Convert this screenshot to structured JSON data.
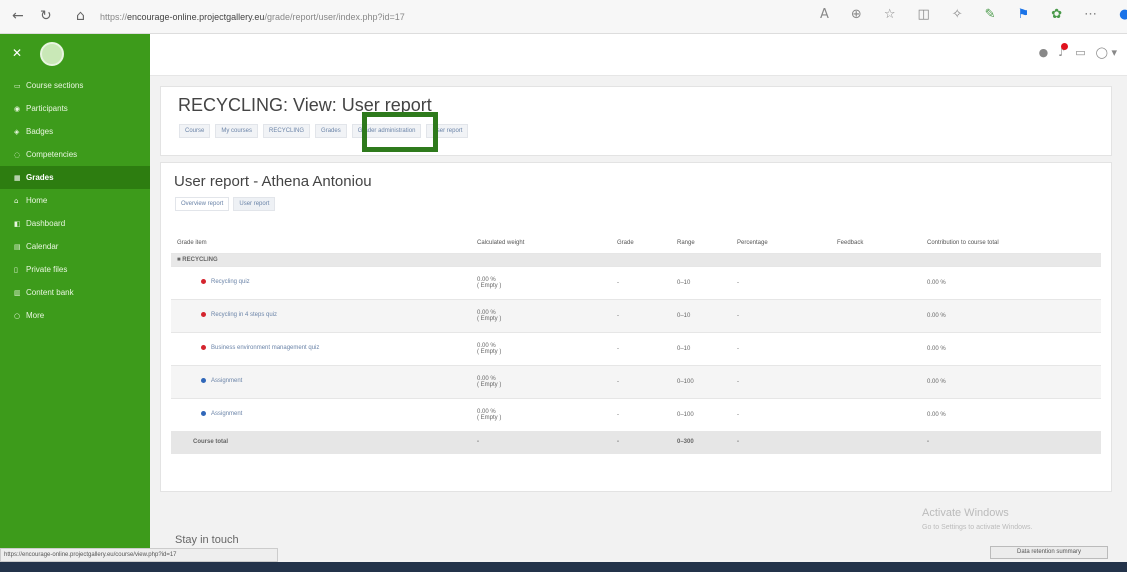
{
  "browser": {
    "url_prefix": "https://",
    "url_host": "encourage-online.projectgallery.eu",
    "url_path": "/grade/report/user/index.php?id=17"
  },
  "sidebar": {
    "items": [
      {
        "label": "Course sections",
        "icon": "folder-icon",
        "active": false
      },
      {
        "label": "Participants",
        "icon": "people-icon",
        "active": false
      },
      {
        "label": "Badges",
        "icon": "badge-icon",
        "active": false
      },
      {
        "label": "Competencies",
        "icon": "check-icon",
        "active": false
      },
      {
        "label": "Grades",
        "icon": "grades-icon",
        "active": true
      },
      {
        "label": "Home",
        "icon": "home-icon",
        "active": false
      },
      {
        "label": "Dashboard",
        "icon": "dashboard-icon",
        "active": false
      },
      {
        "label": "Calendar",
        "icon": "calendar-icon",
        "active": false
      },
      {
        "label": "Private files",
        "icon": "file-icon",
        "active": false
      },
      {
        "label": "Content bank",
        "icon": "bank-icon",
        "active": false
      },
      {
        "label": "More",
        "icon": "more-icon",
        "active": false
      }
    ]
  },
  "header": {
    "title": "RECYCLING: View: User report",
    "tabs": [
      "Course",
      "My courses",
      "RECYCLING",
      "Grades",
      "Grader administration",
      "User report"
    ]
  },
  "report": {
    "title": "User report - Athena Antoniou",
    "tabs": [
      "Overview report",
      "User report"
    ],
    "columns": [
      "Grade item",
      "Calculated weight",
      "Grade",
      "Range",
      "Percentage",
      "Feedback",
      "Contribution to course total"
    ],
    "category": "RECYCLING",
    "rows": [
      {
        "name": "Recycling quiz",
        "type": "red",
        "weight": "0.00 %\n( Empty )",
        "grade": "-",
        "range": "0–10",
        "percentage": "-",
        "feedback": "",
        "contribution": "0.00 %"
      },
      {
        "name": "Recycling in 4 steps quiz",
        "type": "red",
        "weight": "0.00 %\n( Empty )",
        "grade": "-",
        "range": "0–10",
        "percentage": "-",
        "feedback": "",
        "contribution": "0.00 %"
      },
      {
        "name": "Business environment management quiz",
        "type": "red",
        "weight": "0.00 %\n( Empty )",
        "grade": "-",
        "range": "0–10",
        "percentage": "-",
        "feedback": "",
        "contribution": "0.00 %"
      },
      {
        "name": "Assignment",
        "type": "blue",
        "weight": "0.00 %\n( Empty )",
        "grade": "-",
        "range": "0–100",
        "percentage": "-",
        "feedback": "",
        "contribution": "0.00 %"
      },
      {
        "name": "Assignment",
        "type": "blue",
        "weight": "0.00 %\n( Empty )",
        "grade": "-",
        "range": "0–100",
        "percentage": "-",
        "feedback": "",
        "contribution": "0.00 %"
      }
    ],
    "total": {
      "label": "Course total",
      "weight": "-",
      "grade": "-",
      "range": "0–300",
      "percentage": "-",
      "contribution": "-"
    }
  },
  "footer": {
    "stay_in_touch": "Stay in touch",
    "activate_title": "Activate Windows",
    "activate_sub": "Go to Settings to activate Windows.",
    "status_url": "https://encourage-online.projectgallery.eu/course/view.php?id=17",
    "data_button": "Data retention summary"
  }
}
